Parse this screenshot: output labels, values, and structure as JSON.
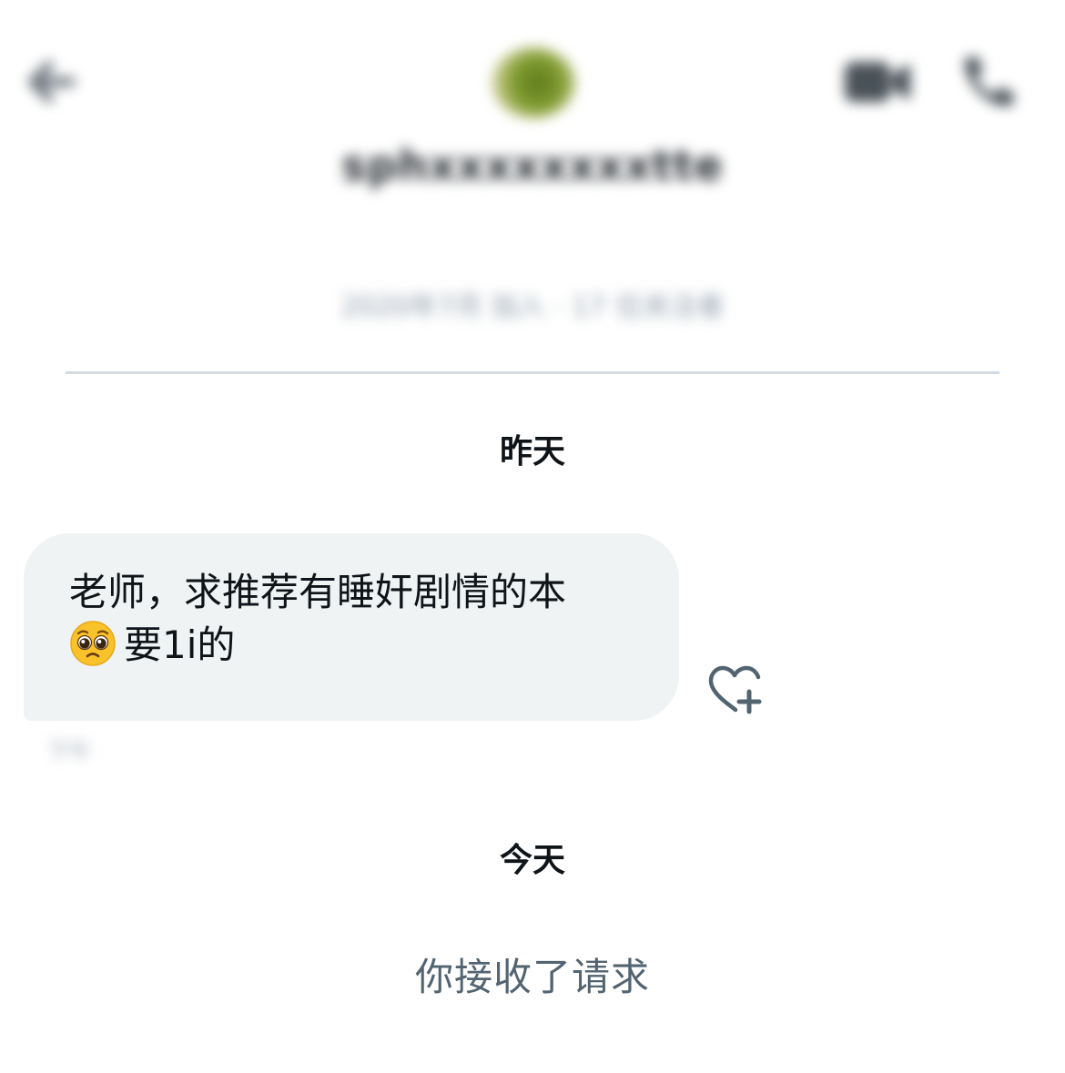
{
  "header": {
    "contact_name": "sphxxxxxxxxtte",
    "contact_meta": "2020年7月 加入 · 17 位关注者"
  },
  "conversation": {
    "date_yesterday": "昨天",
    "message": {
      "text_line1": "老师，求推荐有睡奸剧情的本",
      "text_line2": "要1i的",
      "emoji": "pleading-face",
      "time": "下午"
    },
    "date_today": "今天",
    "system_message": "你接收了请求"
  },
  "colors": {
    "bubble": "#eff3f4",
    "divider": "#d4dbe0",
    "system_text": "#536471",
    "icon_gray": "#536471"
  }
}
